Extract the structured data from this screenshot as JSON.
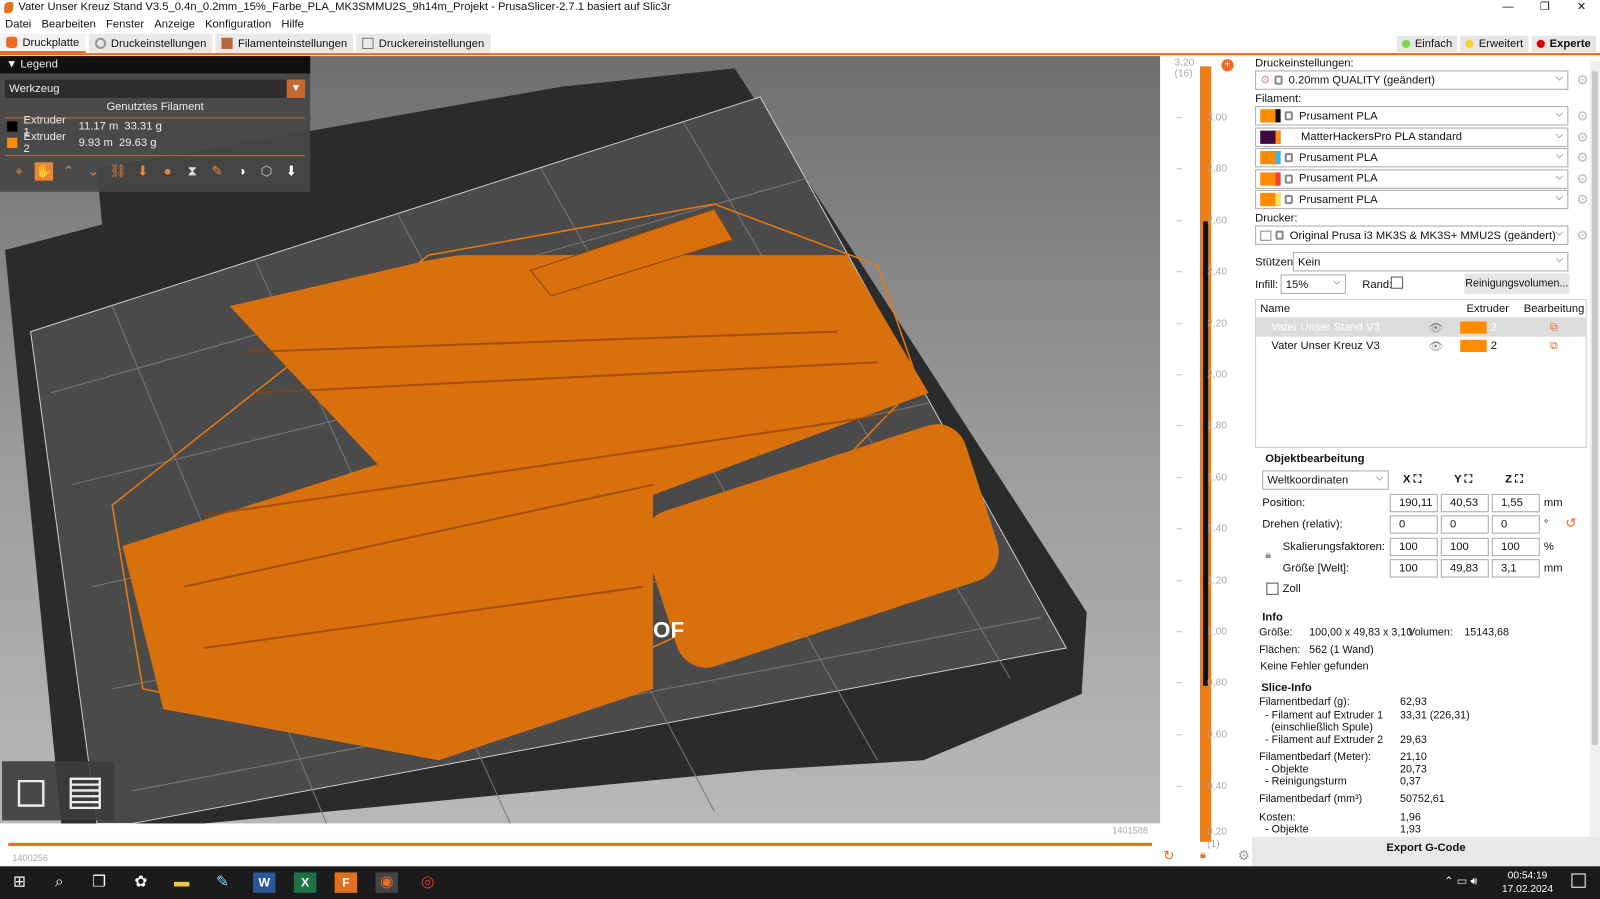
{
  "window": {
    "title": "Vater Unser Kreuz Stand V3.5_0.4n_0.2mm_15%_Farbe_PLA_MK3SMMU2S_9h14m_Projekt - PrusaSlicer-2.7.1 basiert auf Slic3r"
  },
  "menu": [
    "Datei",
    "Bearbeiten",
    "Fenster",
    "Anzeige",
    "Konfiguration",
    "Hilfe"
  ],
  "tabs": [
    {
      "label": "Druckplatte",
      "active": true
    },
    {
      "label": "Druckeinstellungen"
    },
    {
      "label": "Filamenteinstellungen"
    },
    {
      "label": "Druckereinstellungen"
    }
  ],
  "modes": [
    {
      "label": "Einfach",
      "color": "#7ed957"
    },
    {
      "label": "Erweitert",
      "color": "#f5d327"
    },
    {
      "label": "Experte",
      "color": "#e00000",
      "active": true
    }
  ],
  "legend": {
    "title": "Legend",
    "view_type": "Werkzeug",
    "subtitle": "Genutztes Filament",
    "rows": [
      {
        "name": "Extruder 1",
        "length": "11.17 m",
        "weight": "33.31 g",
        "color": "#000000"
      },
      {
        "name": "Extruder 2",
        "length": "9.93 m",
        "weight": "29.63 g",
        "color": "#ff8c00"
      }
    ],
    "icons": [
      "travel-icon",
      "wipe-icon",
      "retraction-icon",
      "deretraction-icon",
      "seams-icon",
      "tool-change-icon",
      "color-change-icon",
      "pause-icon",
      "custom-gcode-icon",
      "center-of-gravity-icon",
      "shells-icon",
      "tool-marker-icon"
    ]
  },
  "scene": {
    "plate_label": "OF"
  },
  "hslider": {
    "left_value": "1400256",
    "right_value": "1401588"
  },
  "vslider": {
    "top_value": "3,20",
    "top_layer": "(16)",
    "bottom_value": "0,20",
    "bottom_layer": "(1)",
    "ticks": [
      "3,00",
      "2,80",
      "2,60",
      "2,40",
      "2,20",
      "2,00",
      "1,80",
      "1,60",
      "1,40",
      "1,20",
      "1,00",
      "0,80",
      "0,60",
      "0,40"
    ]
  },
  "panel": {
    "print_label": "Druckeinstellungen:",
    "print_value": "0.20mm QUALITY (geändert)",
    "filament_label": "Filament:",
    "filaments": [
      {
        "name": "Prusament PLA",
        "color": "#ff8c00",
        "accent": "#111111",
        "locked": true
      },
      {
        "name": "MatterHackersPro PLA standard",
        "color": "#3a0a40",
        "accent": "#ff8c00",
        "locked": false
      },
      {
        "name": "Prusament PLA",
        "color": "#ff8c00",
        "accent": "#3db5f0",
        "locked": true
      },
      {
        "name": "Prusament PLA",
        "color": "#ff8c00",
        "accent": "#f04040",
        "locked": true
      },
      {
        "name": "Prusament PLA",
        "color": "#ff8c00",
        "accent": "#f5e070",
        "locked": true
      }
    ],
    "printer_label": "Drucker:",
    "printer_value": "Original Prusa i3 MK3S & MK3S+ MMU2S (geändert)",
    "supports_label": "Stützen:",
    "supports_value": "Kein",
    "infill_label": "Infill:",
    "infill_value": "15%",
    "brim_label": "Rand:",
    "purge_button": "Reinigungsvolumen...",
    "objects": {
      "headers": [
        "Name",
        "Extruder",
        "Bearbeitung"
      ],
      "rows": [
        {
          "name": "Vater Unser Stand V3",
          "extruder": "2",
          "selected": true
        },
        {
          "name": "Vater Unser Kreuz  V3",
          "extruder": "2"
        }
      ]
    },
    "manip": {
      "title": "Objektbearbeitung",
      "coords": "Weltkoordinaten",
      "axes": [
        "X",
        "Y",
        "Z"
      ],
      "rows": [
        {
          "label": "Position:",
          "values": [
            "190,11",
            "40,53",
            "1,55"
          ],
          "unit": "mm"
        },
        {
          "label": "Drehen (relativ):",
          "values": [
            "0",
            "0",
            "0"
          ],
          "unit": "°"
        },
        {
          "label": "Skalierungsfaktoren:",
          "values": [
            "100",
            "100",
            "100"
          ],
          "unit": "%"
        },
        {
          "label": "Größe [Welt]:",
          "values": [
            "100",
            "49,83",
            "3,1"
          ],
          "unit": "mm"
        }
      ],
      "inches": "Zoll"
    },
    "info": {
      "title": "Info",
      "size_label": "Größe:",
      "size": "100,00 x 49,83 x 3,10",
      "volume_label": "Volumen:",
      "volume": "15143,68",
      "facets_label": "Flächen:",
      "facets": "562 (1 Wand)",
      "errors": "Keine Fehler gefunden"
    },
    "slice": {
      "title": "Slice-Info",
      "rows": [
        {
          "k": "Filamentbedarf (g):",
          "v": "62,93"
        },
        {
          "k": "  - Filament auf Extruder 1",
          "v": "33,31 (226,31)"
        },
        {
          "k": "    (einschließlich Spule)",
          "v": ""
        },
        {
          "k": "  - Filament auf Extruder 2",
          "v": "29,63"
        },
        {
          "k": "Filamentbedarf (Meter):",
          "v": "21,10"
        },
        {
          "k": "  - Objekte",
          "v": "20,73"
        },
        {
          "k": "  - Reinigungsturm",
          "v": "0,37"
        },
        {
          "k": "Filamentbedarf (mm³)",
          "v": "50752,61"
        },
        {
          "k": "Kosten:",
          "v": "1,96"
        },
        {
          "k": "  - Objekte",
          "v": "1,93"
        }
      ]
    },
    "export": "Export G-Code"
  },
  "taskbar": {
    "time": "00:54:19",
    "date": "17.02.2024"
  }
}
